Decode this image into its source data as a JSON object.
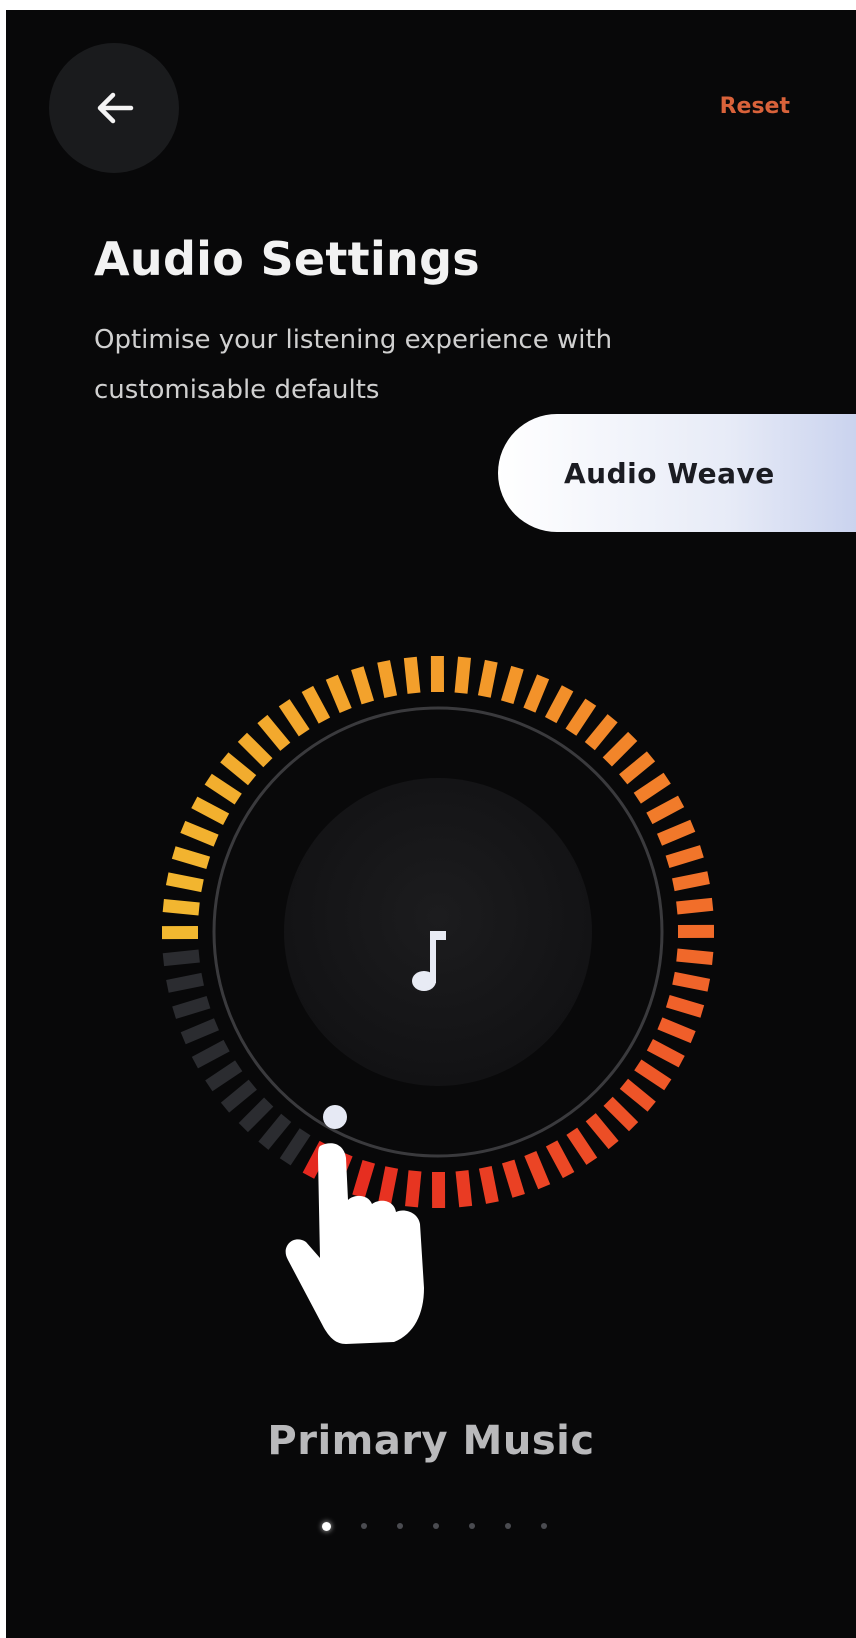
{
  "header": {
    "back_icon": "arrow-left-icon",
    "reset_label": "Reset"
  },
  "page": {
    "title": "Audio Settings",
    "subtitle": "Optimise your listening experience with customisable defaults"
  },
  "mode_button": {
    "label": "Audio Weave"
  },
  "dial": {
    "center_icon": "music-note-icon",
    "level_fraction": 0.84,
    "active_gradient": [
      "#e5281f",
      "#f0602a",
      "#f39a2a",
      "#f2b830"
    ],
    "inactive_color": "#2b2c30",
    "ring_color": "#3a3a3d"
  },
  "preset": {
    "label": "Primary Music"
  },
  "pagination": {
    "total": 7,
    "active_index": 0
  },
  "colors": {
    "accent": "#d9623a",
    "background": "#080809"
  }
}
